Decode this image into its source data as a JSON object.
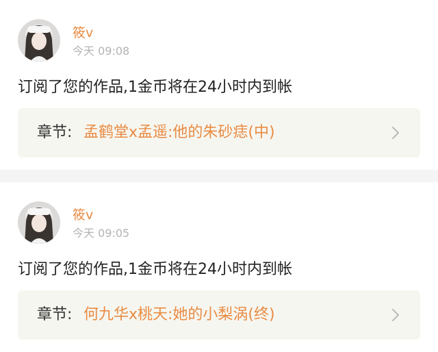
{
  "notifications": [
    {
      "user_name": "筱v",
      "time": "今天 09:08",
      "message": "订阅了您的作品,1金币将在24小时内到帐",
      "chapter_label": "章节:",
      "chapter_title": "孟鹤堂x孟遥:他的朱砂痣(中)",
      "chevron_icon": "chevron-right-icon",
      "avatar_icon": "avatar-photo"
    },
    {
      "user_name": "筱v",
      "time": "今天 09:05",
      "message": "订阅了您的作品,1金币将在24小时内到帐",
      "chapter_label": "章节:",
      "chapter_title": "何九华x桃天:她的小梨涡(终)",
      "chevron_icon": "chevron-right-icon",
      "avatar_icon": "avatar-photo"
    }
  ],
  "colors": {
    "accent": "#e98b43",
    "divider": "#f4f4f4",
    "chapter_bg": "#f6f6f0",
    "timestamp": "#b3b3b3"
  }
}
